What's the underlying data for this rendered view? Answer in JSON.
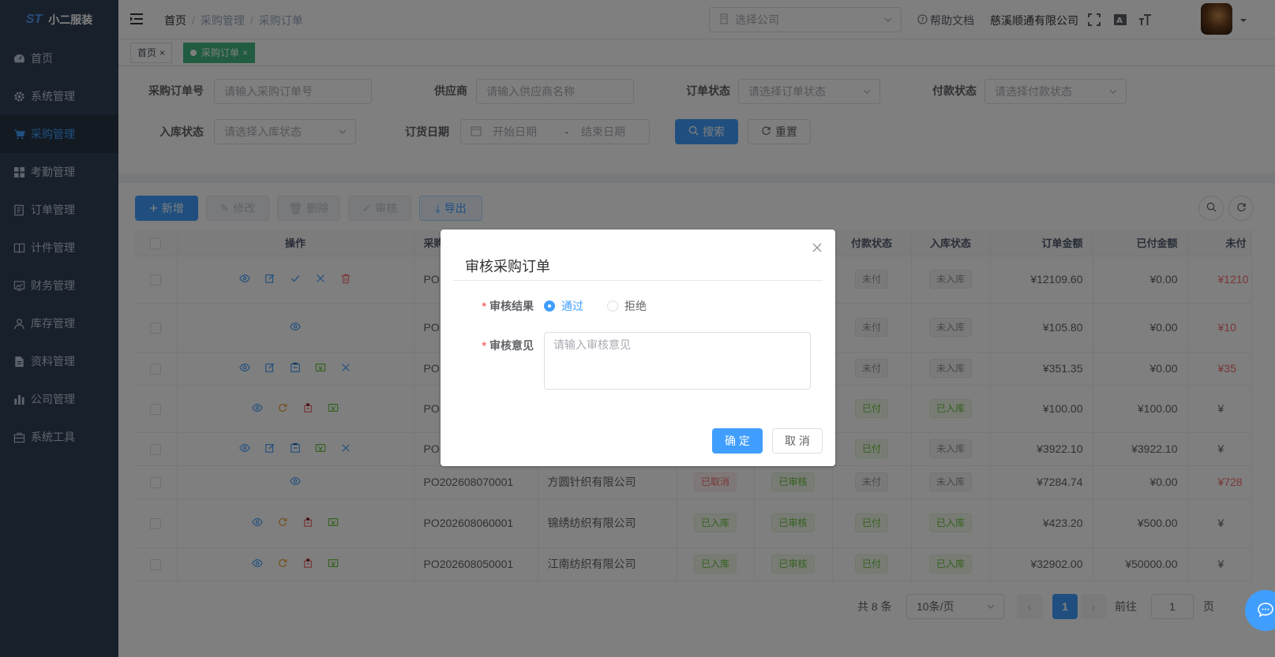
{
  "app": {
    "logo_text": "小二服装",
    "logo_mark": "ST"
  },
  "sidebar": {
    "items": [
      {
        "label": "首页",
        "icon": "dashboard-icon"
      },
      {
        "label": "系统管理",
        "icon": "gear-icon"
      },
      {
        "label": "采购管理",
        "icon": "shopping-cart-icon",
        "active": true
      },
      {
        "label": "考勤管理",
        "icon": "grid-icon"
      },
      {
        "label": "订单管理",
        "icon": "list-icon"
      },
      {
        "label": "计件管理",
        "icon": "book-icon"
      },
      {
        "label": "财务管理",
        "icon": "chart-icon"
      },
      {
        "label": "库存管理",
        "icon": "user-icon"
      },
      {
        "label": "资料管理",
        "icon": "document-icon"
      },
      {
        "label": "公司管理",
        "icon": "bar-chart-icon"
      },
      {
        "label": "系统工具",
        "icon": "toolbox-icon"
      }
    ]
  },
  "navbar": {
    "breadcrumb": [
      "首页",
      "采购管理",
      "采购订单"
    ],
    "company_select_placeholder": "选择公司",
    "help_label": "帮助文档",
    "company_name": "慈溪顺通有限公司"
  },
  "tags": [
    {
      "label": "首页"
    },
    {
      "label": "采购订单",
      "active": true
    }
  ],
  "search": {
    "po_no_label": "采购订单号",
    "po_no_placeholder": "请输入采购订单号",
    "supplier_label": "供应商",
    "supplier_placeholder": "请输入供应商名称",
    "order_status_label": "订单状态",
    "order_status_placeholder": "请选择订单状态",
    "pay_status_label": "付款状态",
    "pay_status_placeholder": "请选择付款状态",
    "stock_status_label": "入库状态",
    "stock_status_placeholder": "请选择入库状态",
    "date_label": "订货日期",
    "date_start": "开始日期",
    "date_sep": "-",
    "date_end": "结束日期",
    "search_btn": "搜索",
    "reset_btn": "重置"
  },
  "toolbar": {
    "add": "新增",
    "edit": "修改",
    "delete": "删除",
    "audit": "审核",
    "export": "导出"
  },
  "table": {
    "headers": [
      "操作",
      "采购",
      "付款状态",
      "入库状态",
      "订单金额",
      "已付金额",
      "未付"
    ],
    "rows": [
      {
        "po": "PO",
        "supplier": "",
        "order_status": "",
        "audit_status": "",
        "pay": "未付",
        "stock": "未入库",
        "amount": "¥12109.60",
        "paid": "¥0.00",
        "unpaid": "¥1210",
        "actions": [
          "view",
          "edit",
          "check",
          "close",
          "delete"
        ]
      },
      {
        "po": "PO",
        "supplier": "",
        "order_status": "",
        "audit_status": "",
        "pay": "未付",
        "stock": "未入库",
        "amount": "¥105.80",
        "paid": "¥0.00",
        "unpaid": "¥10",
        "actions": [
          "view"
        ]
      },
      {
        "po": "PO",
        "supplier": "",
        "order_status": "",
        "audit_status": "",
        "pay": "未付",
        "stock": "未入库",
        "amount": "¥351.35",
        "paid": "¥0.00",
        "unpaid": "¥35",
        "actions": [
          "view",
          "edit",
          "stock",
          "pay",
          "close"
        ]
      },
      {
        "po": "PO",
        "supplier": "",
        "order_status": "",
        "audit_status": "",
        "pay": "已付",
        "stock": "已入库",
        "amount": "¥100.00",
        "paid": "¥100.00",
        "unpaid": "¥",
        "actions": [
          "view",
          "refresh",
          "return",
          "pay"
        ]
      },
      {
        "po": "PO",
        "supplier": "",
        "order_status": "",
        "audit_status": "",
        "pay": "已付",
        "stock": "未入库",
        "amount": "¥3922.10",
        "paid": "¥3922.10",
        "unpaid": "¥",
        "actions": [
          "view",
          "edit",
          "stock",
          "pay",
          "close"
        ]
      },
      {
        "po": "PO202608070001",
        "supplier": "方圆针织有限公司",
        "order_status": "已取消",
        "audit_status": "已审核",
        "pay": "未付",
        "stock": "未入库",
        "amount": "¥7284.74",
        "paid": "¥0.00",
        "unpaid": "¥728",
        "actions": [
          "view"
        ]
      },
      {
        "po": "PO202608060001",
        "supplier": "锦绣纺织有限公司",
        "order_status": "已入库",
        "audit_status": "已审核",
        "pay": "已付",
        "stock": "已入库",
        "amount": "¥423.20",
        "paid": "¥500.00",
        "unpaid": "¥",
        "actions": [
          "view",
          "refresh",
          "return",
          "pay"
        ]
      },
      {
        "po": "PO202608050001",
        "supplier": "江南纺织有限公司",
        "order_status": "已入库",
        "audit_status": "已审核",
        "pay": "已付",
        "stock": "已入库",
        "amount": "¥32902.00",
        "paid": "¥50000.00",
        "unpaid": "¥",
        "actions": [
          "view",
          "refresh",
          "return",
          "pay"
        ]
      }
    ]
  },
  "pagination": {
    "total": "共 8 条",
    "page_size": "10条/页",
    "current": "1",
    "goto_label": "前往",
    "goto_value": "1",
    "page_unit": "页"
  },
  "dialog": {
    "title": "审核采购订单",
    "result_label": "审核结果",
    "pass_label": "通过",
    "reject_label": "拒绝",
    "opinion_label": "审核意见",
    "opinion_placeholder": "请输入审核意见",
    "confirm_btn": "确 定",
    "cancel_btn": "取 消"
  },
  "colors": {
    "primary": "#409eff",
    "sidebar_bg": "#304156",
    "tag_active": "#42b983",
    "danger": "#f56c6c",
    "success": "#67c23a"
  }
}
